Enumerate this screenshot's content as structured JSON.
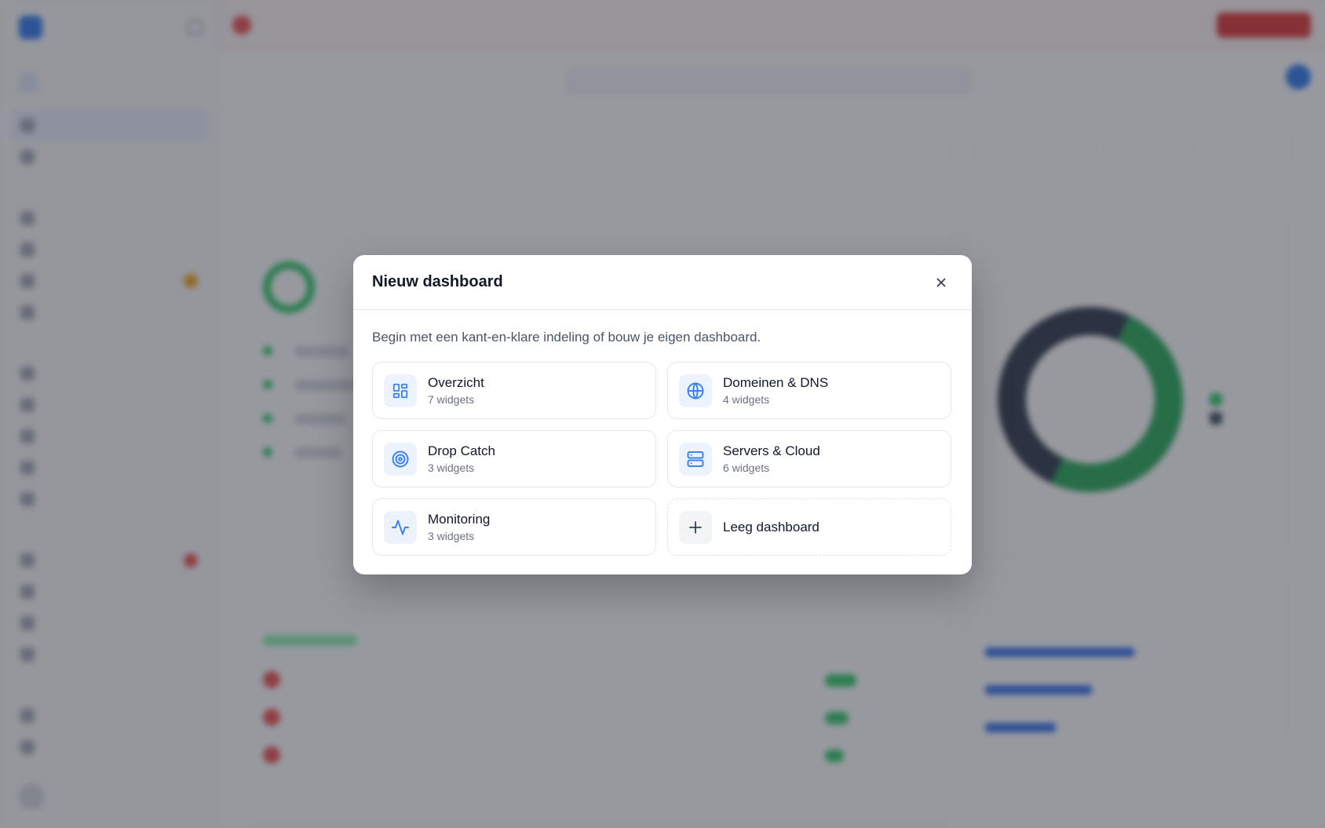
{
  "modal": {
    "title": "Nieuw dashboard",
    "close_icon": "close-icon",
    "description": "Begin met een kant-en-klare indeling of bouw je eigen dashboard.",
    "templates": [
      {
        "name": "Overzicht",
        "count": "7 widgets",
        "icon": "layout-grid-icon"
      },
      {
        "name": "Domeinen & DNS",
        "count": "4 widgets",
        "icon": "globe-icon"
      },
      {
        "name": "Drop Catch",
        "count": "3 widgets",
        "icon": "target-icon"
      },
      {
        "name": "Servers & Cloud",
        "count": "6 widgets",
        "icon": "server-icon"
      },
      {
        "name": "Monitoring",
        "count": "3 widgets",
        "icon": "activity-icon"
      },
      {
        "name": "Leeg dashboard",
        "icon": "plus-icon"
      }
    ]
  },
  "colors": {
    "accent": "#2563eb",
    "icon_bg": "#edf3fd",
    "overlay": "rgba(55,60,70,0.52)",
    "danger": "#dc2626",
    "success": "#16a34a"
  }
}
